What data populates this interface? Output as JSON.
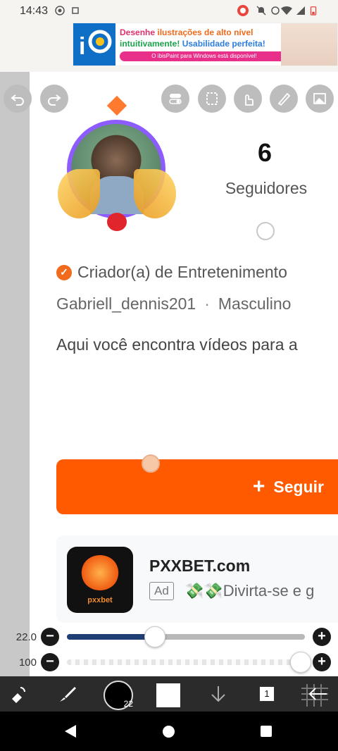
{
  "status_bar": {
    "time": "14:43"
  },
  "banner": {
    "line1_highlight": "Desenhe ",
    "line1_rest": "ilustrações de alto nível",
    "line2_a": "intuitivamente! ",
    "line2_b": "Usabilidade perfeita!",
    "pill_text": "O ibisPaint para Windows está disponível!"
  },
  "profile": {
    "followers_count": "6",
    "followers_label": "Seguidores",
    "creator_badge": "✓",
    "creator_type": "Criador(a) de Entretenimento",
    "username": "Gabriell_dennis201",
    "separator": "·",
    "gender": "Masculino",
    "bio": "Aqui você encontra vídeos para a"
  },
  "follow_button": {
    "plus": "+",
    "label": "Seguir"
  },
  "ad": {
    "title": "PXXBET.com",
    "badge": "Ad",
    "subtitle": "💸💸Divirta-se e g",
    "logo_text": "pxxbet"
  },
  "sliders": {
    "size_label": "22.0",
    "opacity_label": "100",
    "size_fraction": 0.37,
    "opacity_fraction": 1.0,
    "minus": "−",
    "plus": "+"
  },
  "bottom_tools": {
    "brush_size": "22",
    "layer_number": "1"
  },
  "colors": {
    "accent": "#ff5a00",
    "slider_fill": "#1f3f74",
    "toolbar_bg": "#2b2b2b"
  }
}
